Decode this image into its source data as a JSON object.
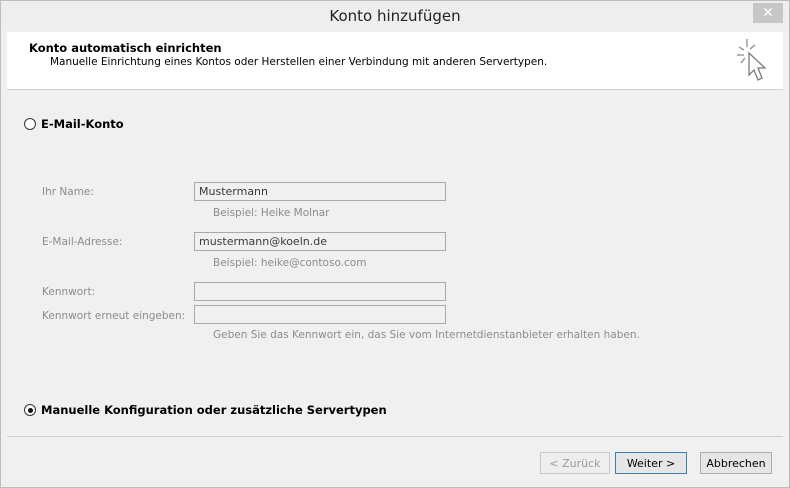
{
  "window": {
    "title": "Konto hinzufügen",
    "close_glyph": "✕"
  },
  "header": {
    "title": "Konto automatisch einrichten",
    "subtitle": "Manuelle Einrichtung eines Kontos oder Herstellen einer Verbindung mit anderen Servertypen.",
    "icon": "wizard-cursor-icon"
  },
  "options": {
    "email_account": {
      "label": "E-Mail-Konto",
      "selected": false
    },
    "manual_config": {
      "label": "Manuelle Konfiguration oder zusätzliche Servertypen",
      "selected": true
    }
  },
  "form": {
    "name": {
      "label": "Ihr Name:",
      "value": "Mustermann",
      "hint": "Beispiel: Heike Molnar"
    },
    "email": {
      "label": "E-Mail-Adresse:",
      "value": "mustermann@koeln.de",
      "hint": "Beispiel: heike@contoso.com"
    },
    "password": {
      "label": "Kennwort:",
      "value": ""
    },
    "password_repeat": {
      "label": "Kennwort erneut eingeben:",
      "value": ""
    },
    "password_hint": "Geben Sie das Kennwort ein, das Sie vom Internetdienstanbieter erhalten haben."
  },
  "buttons": {
    "back": "< Zurück",
    "next": "Weiter >",
    "cancel": "Abbrechen"
  }
}
